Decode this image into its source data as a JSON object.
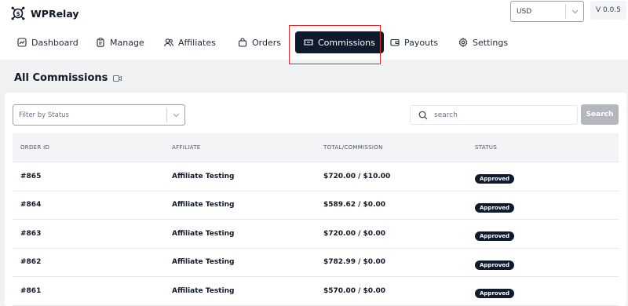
{
  "app": {
    "name": "WPRelay",
    "version": "V 0.0.5"
  },
  "currency": {
    "selected": "USD"
  },
  "nav": {
    "items": [
      {
        "label": "Dashboard",
        "icon": "chart-icon"
      },
      {
        "label": "Manage",
        "icon": "clipboard-icon"
      },
      {
        "label": "Affiliates",
        "icon": "users-icon"
      },
      {
        "label": "Orders",
        "icon": "bag-icon"
      },
      {
        "label": "Commissions",
        "icon": "ticket-icon",
        "active": true
      },
      {
        "label": "Payouts",
        "icon": "wallet-icon"
      },
      {
        "label": "Settings",
        "icon": "gear-icon"
      }
    ]
  },
  "page": {
    "title": "All Commissions"
  },
  "filter": {
    "placeholder": "Filter by Status"
  },
  "search": {
    "placeholder": "search",
    "button_label": "Search"
  },
  "table": {
    "headers": [
      "ORDER ID",
      "AFFILIATE",
      "TOTAL/COMMISSION",
      "STATUS"
    ],
    "rows": [
      {
        "order_id": "#865",
        "affiliate": "Affiliate Testing",
        "total": "$720.00 / $10.00",
        "status": "Approved"
      },
      {
        "order_id": "#864",
        "affiliate": "Affiliate Testing",
        "total": "$589.62 / $0.00",
        "status": "Approved"
      },
      {
        "order_id": "#863",
        "affiliate": "Affiliate Testing",
        "total": "$720.00 / $0.00",
        "status": "Approved"
      },
      {
        "order_id": "#862",
        "affiliate": "Affiliate Testing",
        "total": "$782.99 / $0.00",
        "status": "Approved"
      },
      {
        "order_id": "#861",
        "affiliate": "Affiliate Testing",
        "total": "$570.00 / $0.00",
        "status": "Approved"
      }
    ]
  },
  "colors": {
    "nav_active_bg": "#0f1b2d",
    "highlight": "#d32f2f",
    "badge_bg": "#0f1b2d"
  }
}
